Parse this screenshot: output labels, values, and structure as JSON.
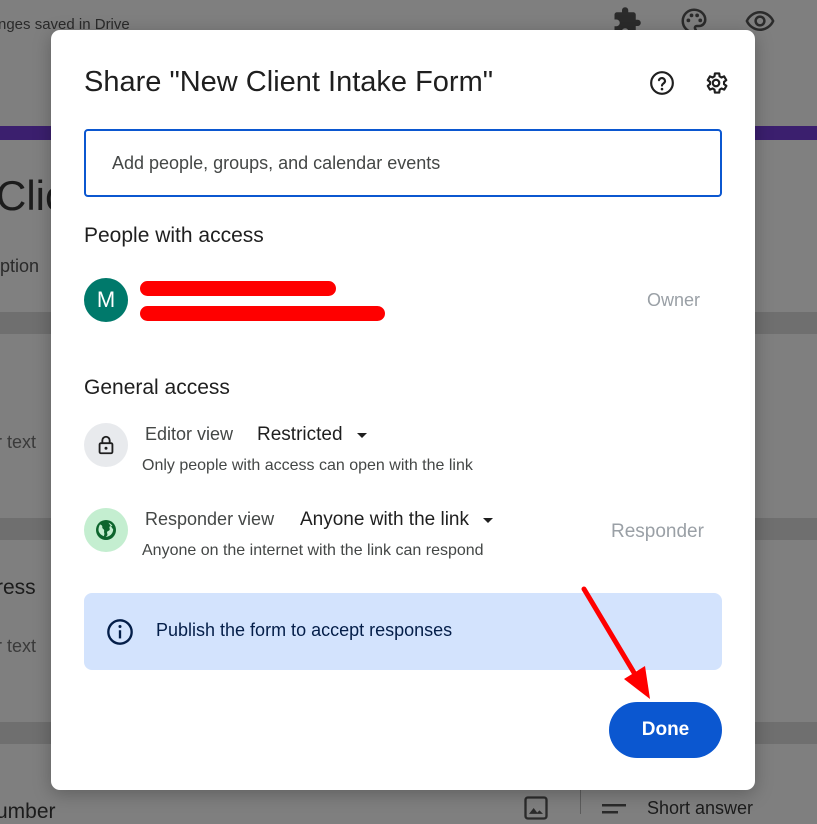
{
  "background": {
    "save_status": "nges saved in Drive",
    "form_title_fragment": "Clic",
    "description_fragment": "iption",
    "answer_placeholder_1": "r text",
    "question_2_fragment": "ress",
    "answer_placeholder_2": "r text",
    "question_3_fragment": "umber",
    "question_type": "Short answer"
  },
  "dialog": {
    "title": "Share \"New Client Intake Form\"",
    "help_icon": "help-circle-icon",
    "settings_icon": "gear-icon",
    "input_placeholder": "Add people, groups, and calendar events",
    "people_heading": "People with access",
    "person": {
      "avatar_letter": "M",
      "avatar_color": "#00796b",
      "role": "Owner"
    },
    "general_heading": "General access",
    "editor": {
      "label": "Editor view",
      "value": "Restricted",
      "description": "Only people with access can open with the link",
      "icon": "lock-icon"
    },
    "responder": {
      "label": "Responder view",
      "value": "Anyone with the link",
      "description": "Anyone on the internet with the link can respond",
      "role": "Responder",
      "icon": "globe-icon"
    },
    "notice": {
      "text": "Publish the form to accept responses",
      "icon": "info-icon"
    },
    "done_label": "Done"
  },
  "colors": {
    "accent": "#0b57d0",
    "notice_bg": "#d3e3fd",
    "redaction": "#ff0000",
    "annotation_arrow": "#ff0000"
  }
}
